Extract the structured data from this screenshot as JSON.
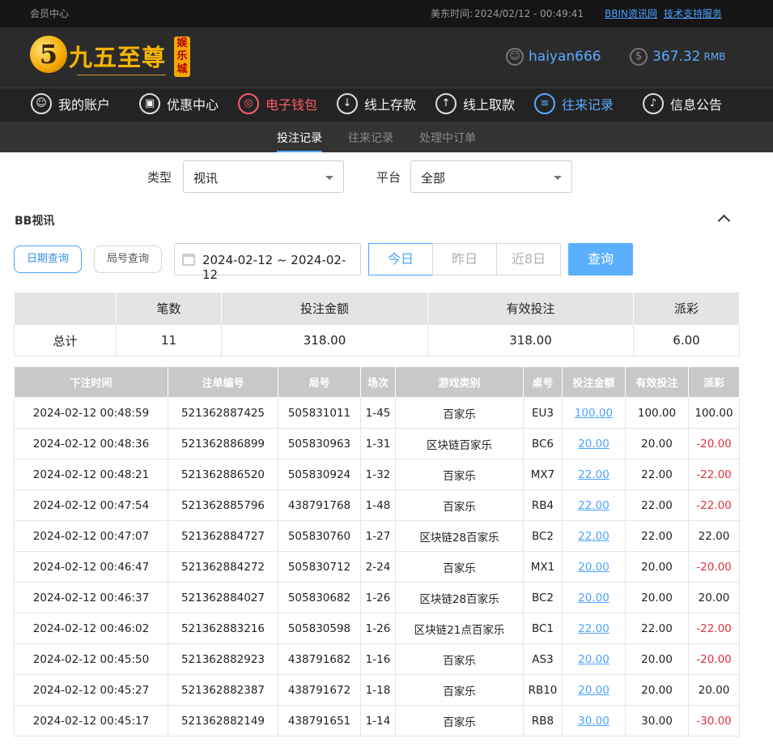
{
  "topbar": {
    "member_center": "会员中心",
    "time_label": "美东时间:",
    "time_value": "2024/02/12 - 00:49:41",
    "link_bbin": "BBIN资讯网",
    "link_support": "技术支持服务"
  },
  "header": {
    "logo_digit": "5",
    "logo_name": "九五至尊",
    "logo_tag": "娱乐城",
    "username": "haiyan666",
    "balance": "367.32",
    "currency": "RMB"
  },
  "nav": [
    {
      "label": "我的账户",
      "icon": "user-icon"
    },
    {
      "label": "优惠中心",
      "icon": "gift-icon"
    },
    {
      "label": "电子钱包",
      "icon": "wallet-icon"
    },
    {
      "label": "线上存款",
      "icon": "deposit-icon"
    },
    {
      "label": "线上取款",
      "icon": "withdraw-icon"
    },
    {
      "label": "往来记录",
      "icon": "record-icon"
    },
    {
      "label": "信息公告",
      "icon": "bell-icon"
    }
  ],
  "subtabs": [
    "投注记录",
    "往来记录",
    "处理中订单"
  ],
  "filters": {
    "type_label": "类型",
    "type_value": "视讯",
    "platform_label": "平台",
    "platform_value": "全部"
  },
  "section_title": "BB视讯",
  "query": {
    "date_query": "日期查询",
    "round_query": "局号查询",
    "date_range": "2024-02-12 ~ 2024-02-12",
    "today": "今日",
    "yesterday": "昨日",
    "last8": "近8日",
    "search": "查询"
  },
  "summary": {
    "headers": [
      "",
      "笔数",
      "投注金额",
      "有效投注",
      "派彩"
    ],
    "row": [
      "总计",
      "11",
      "318.00",
      "318.00",
      "6.00"
    ]
  },
  "detail": {
    "headers": [
      "下注时间",
      "注单编号",
      "局号",
      "场次",
      "游戏类别",
      "桌号",
      "投注金额",
      "有效投注",
      "派彩"
    ],
    "rows": [
      [
        "2024-02-12 00:48:59",
        "521362887425",
        "505831011",
        "1-45",
        "百家乐",
        "EU3",
        "100.00",
        "100.00",
        "100.00"
      ],
      [
        "2024-02-12 00:48:36",
        "521362886899",
        "505830963",
        "1-31",
        "区块链百家乐",
        "BC6",
        "20.00",
        "20.00",
        "-20.00"
      ],
      [
        "2024-02-12 00:48:21",
        "521362886520",
        "505830924",
        "1-32",
        "百家乐",
        "MX7",
        "22.00",
        "22.00",
        "-22.00"
      ],
      [
        "2024-02-12 00:47:54",
        "521362885796",
        "438791768",
        "1-48",
        "百家乐",
        "RB4",
        "22.00",
        "22.00",
        "-22.00"
      ],
      [
        "2024-02-12 00:47:07",
        "521362884727",
        "505830760",
        "1-27",
        "区块链28百家乐",
        "BC2",
        "22.00",
        "22.00",
        "22.00"
      ],
      [
        "2024-02-12 00:46:47",
        "521362884272",
        "505830712",
        "2-24",
        "百家乐",
        "MX1",
        "20.00",
        "20.00",
        "-20.00"
      ],
      [
        "2024-02-12 00:46:37",
        "521362884027",
        "505830682",
        "1-26",
        "区块链28百家乐",
        "BC2",
        "20.00",
        "20.00",
        "20.00"
      ],
      [
        "2024-02-12 00:46:02",
        "521362883216",
        "505830598",
        "1-26",
        "区块链21点百家乐",
        "BC1",
        "22.00",
        "22.00",
        "-22.00"
      ],
      [
        "2024-02-12 00:45:50",
        "521362882923",
        "438791682",
        "1-16",
        "百家乐",
        "AS3",
        "20.00",
        "20.00",
        "-20.00"
      ],
      [
        "2024-02-12 00:45:27",
        "521362882387",
        "438791672",
        "1-18",
        "百家乐",
        "RB10",
        "20.00",
        "20.00",
        "20.00"
      ],
      [
        "2024-02-12 00:45:17",
        "521362882149",
        "438791651",
        "1-14",
        "百家乐",
        "RB8",
        "30.00",
        "30.00",
        "-30.00"
      ]
    ]
  },
  "colors": {
    "accent": "#5aa9ff",
    "negative": "#e0303a",
    "wallet": "#ff5a6a",
    "gold": "#f7b500"
  }
}
